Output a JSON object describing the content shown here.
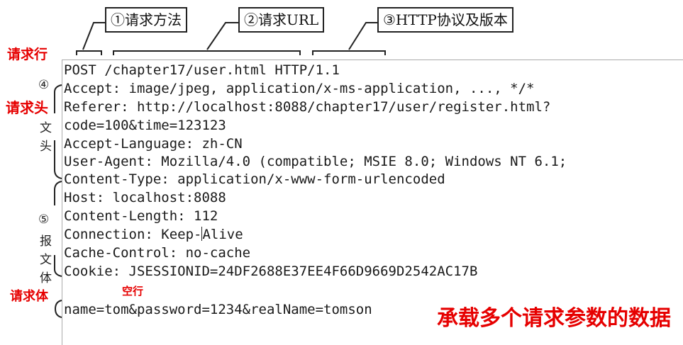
{
  "callouts": {
    "method": "①请求方法",
    "url": "②请求URL",
    "protocol": "③HTTP协议及版本"
  },
  "labels": {
    "request_line": "请求行",
    "request_header": "请求头",
    "request_body": "请求体",
    "blank_line": "空行",
    "body_note": "承载多个请求参数的数据"
  },
  "side_annotations": {
    "header_num": "④",
    "header_chars": [
      "文",
      "头"
    ],
    "msg_num": "⑤",
    "msg_chars": [
      "报",
      "文",
      "体"
    ]
  },
  "request": {
    "line": "POST /chapter17/user.html HTTP/1.1",
    "headers": [
      "Accept: image/jpeg, application/x-ms-application, ..., */*",
      "Referer: http://localhost:8088/chapter17/user/register.html?",
      "code=100&time=123123",
      "Accept-Language: zh-CN",
      "User-Agent: Mozilla/4.0 (compatible; MSIE 8.0; Windows NT 6.1;",
      "Content-Type: application/x-www-form-urlencoded",
      "Host: localhost:8088",
      "Content-Length: 112",
      "Connection: Keep-",
      "Cache-Control: no-cache",
      "Cookie: JSESSIONID=24DF2688E37EE4F66D9669D2542AC17B"
    ],
    "connection_tail": "Alive",
    "body": "name=tom&password=1234&realName=tomson"
  }
}
